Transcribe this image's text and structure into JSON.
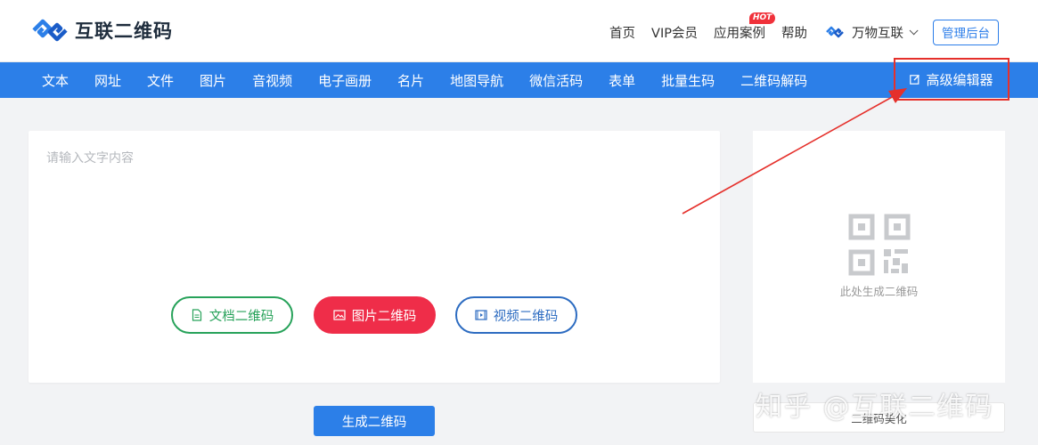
{
  "header": {
    "logo_text": "互联二维码",
    "nav": [
      {
        "label": "首页"
      },
      {
        "label": "VIP会员"
      },
      {
        "label": "应用案例",
        "badge": "HOT"
      },
      {
        "label": "帮助"
      }
    ],
    "brand_dropdown": "万物互联",
    "admin_button": "管理后台"
  },
  "navbar": {
    "items": [
      "文本",
      "网址",
      "文件",
      "图片",
      "音视频",
      "电子画册",
      "名片",
      "地图导航",
      "微信活码",
      "表单",
      "批量生码",
      "二维码解码"
    ],
    "advanced_editor": "高级编辑器"
  },
  "main": {
    "placeholder": "请输入文字内容",
    "pills": {
      "doc": "文档二维码",
      "image": "图片二维码",
      "video": "视频二维码"
    },
    "generate_button": "生成二维码"
  },
  "preview": {
    "text": "此处生成二维码",
    "beautify_button": "二维码美化"
  },
  "watermark": "知乎 @互联二维码",
  "colors": {
    "primary": "#2c7fe8",
    "doc_green": "#27a25a",
    "image_red": "#ef2d49",
    "video_blue": "#2d6cc1",
    "annotation_red": "#e5302b"
  }
}
